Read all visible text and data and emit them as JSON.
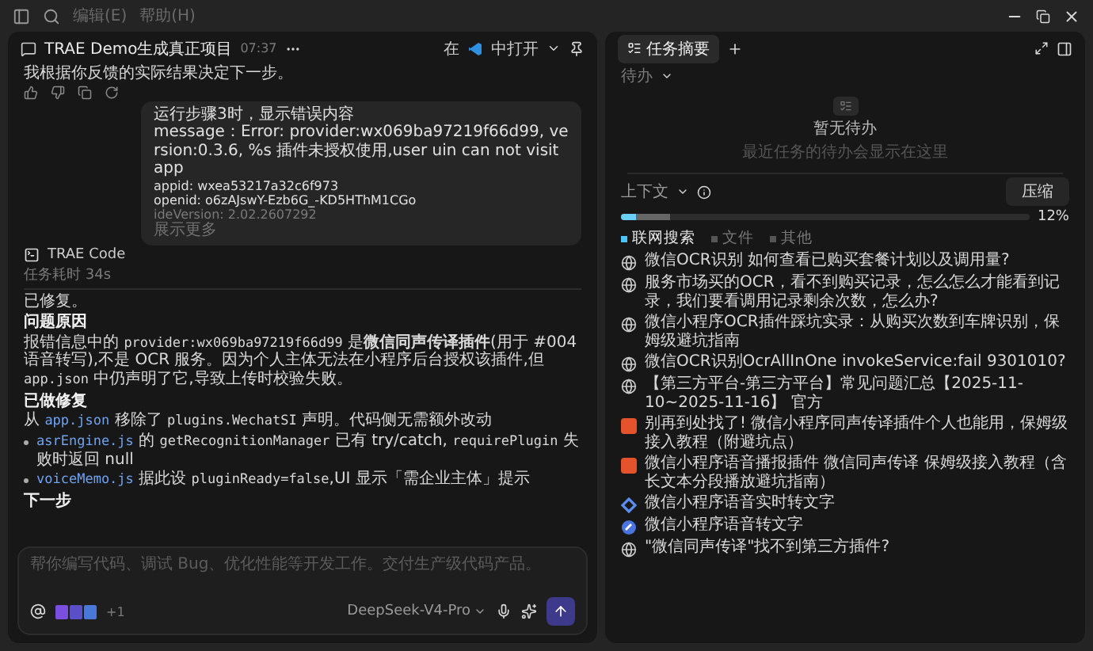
{
  "title_bar": {
    "menus": [
      "编辑(E)",
      "帮助(H)"
    ]
  },
  "chat": {
    "title": "TRAE Demo生成真正项目",
    "time": "07:37",
    "open_in_before": "在",
    "open_in_after": "中打开",
    "assistant_intro": "我根据你反馈的实际结果决定下一步。",
    "user_message": {
      "lines": [
        "运行步骤3时，显示错误内容",
        "message：Error: provider:wx069ba97219f66d99, version:0.3.6, %s 插件未授权使用,user uin can not visit app",
        "appid: wxea53217a32c6f973",
        "openid: o6zAJswY-Ezb6G_-KD5HThM1CGo"
      ],
      "faded_line": "ideVersion: 2.02.2607292",
      "show_more": "展示更多"
    },
    "agent_name": "TRAE Code",
    "duration": "任务耗时 34s",
    "reply": [
      {
        "kind": "text",
        "parts": [
          {
            "kind": "plain",
            "text": "已修复。"
          }
        ]
      },
      {
        "kind": "heading",
        "parts": [
          {
            "kind": "plain",
            "text": "问题原因"
          }
        ]
      },
      {
        "kind": "text",
        "parts": [
          {
            "kind": "plain",
            "text": "报错信息中的 "
          },
          {
            "kind": "code",
            "text": "provider:wx069ba97219f66d99"
          },
          {
            "kind": "plain",
            "text": " 是"
          },
          {
            "kind": "bold",
            "text": "微信同声传译插件"
          },
          {
            "kind": "plain",
            "text": "(用于 #004 语音转写),不是 OCR 服务。因为个人主体无法在小程序后台授权该插件,但 "
          },
          {
            "kind": "code",
            "text": "app.json"
          },
          {
            "kind": "plain",
            "text": " 中仍声明了它,导致上传时校验失败。"
          }
        ]
      },
      {
        "kind": "heading",
        "parts": [
          {
            "kind": "plain",
            "text": "已做修复"
          }
        ]
      },
      {
        "kind": "text",
        "parts": [
          {
            "kind": "plain",
            "text": "从 "
          },
          {
            "kind": "file",
            "text": "app.json"
          },
          {
            "kind": "plain",
            "text": " 移除了 "
          },
          {
            "kind": "code",
            "text": "plugins.WechatSI"
          },
          {
            "kind": "plain",
            "text": " 声明。代码侧无需额外改动"
          }
        ]
      },
      {
        "kind": "bullet",
        "parts": [
          {
            "kind": "file",
            "text": "asrEngine.js"
          },
          {
            "kind": "plain",
            "text": " 的 "
          },
          {
            "kind": "code",
            "text": "getRecognitionManager"
          },
          {
            "kind": "plain",
            "text": " 已有 try/catch, "
          },
          {
            "kind": "code",
            "text": "requirePlugin"
          },
          {
            "kind": "plain",
            "text": " 失败时返回 null"
          }
        ]
      },
      {
        "kind": "bullet",
        "parts": [
          {
            "kind": "file",
            "text": "voiceMemo.js"
          },
          {
            "kind": "plain",
            "text": " 据此设 "
          },
          {
            "kind": "code",
            "text": "pluginReady=false"
          },
          {
            "kind": "plain",
            "text": ",UI 显示「需企业主体」提示"
          }
        ]
      },
      {
        "kind": "heading",
        "parts": [
          {
            "kind": "plain",
            "text": "下一步"
          }
        ]
      }
    ],
    "input": {
      "placeholder": "帮你编写代码、调试 Bug、优化性能等开发工作。交付生产级代码产品。",
      "attachment_extra": "+1",
      "model": "DeepSeek-V4-Pro"
    }
  },
  "panel": {
    "tabs": [
      {
        "label": "任务摘要",
        "selected": true
      }
    ],
    "todo_filter": "待办",
    "empty_title": "暂无待办",
    "empty_hint": "最近任务的待办会显示在这里",
    "context": {
      "label": "上下文",
      "compress": "压缩",
      "level": 0.12,
      "reading": "12%"
    },
    "source_tabs": [
      {
        "label": "联网搜索",
        "selected": true
      },
      {
        "label": "文件",
        "selected": false
      },
      {
        "label": "其他",
        "selected": false
      }
    ],
    "results": [
      {
        "kind": "web",
        "title": "微信OCR识别 如何查看已购买套餐计划以及调用量?"
      },
      {
        "kind": "web",
        "title": "服务市场买的OCR，看不到购买记录，怎么怎么才能看到记录，我们要看调用记录剩余次数，怎么办?"
      },
      {
        "kind": "web",
        "title": "微信小程序OCR插件踩坑实录：从购买次数到车牌识别，保姆级避坑指南"
      },
      {
        "kind": "web",
        "title": "微信OCR识别OcrAllInOne invokeService:fail 9301010?"
      },
      {
        "kind": "web",
        "title": "【第三方平台-第三方平台】常见问题汇总【2025-11-10~2025-11-16】 官方"
      },
      {
        "kind": "blog",
        "title": "别再到处找了! 微信小程序同声传译插件个人也能用，保姆级接入教程（附避坑点）"
      },
      {
        "kind": "blog",
        "title": "微信小程序语音播报插件 微信同声传译 保姆级接入教程（含长文本分段播放避坑指南）"
      },
      {
        "kind": "diamond",
        "title": "微信小程序语音实时转文字"
      },
      {
        "kind": "circle",
        "title": "微信小程序语音转文字"
      },
      {
        "kind": "web",
        "title": "\"微信同声传译\"找不到第三方插件?"
      }
    ]
  }
}
